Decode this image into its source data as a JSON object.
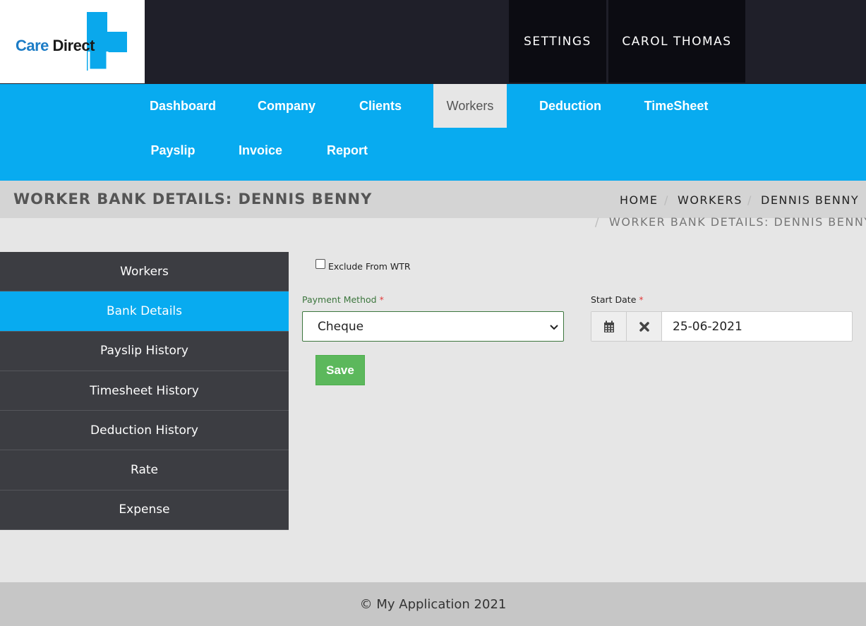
{
  "logo": {
    "text_care": "Care",
    "text_direct": "Direct"
  },
  "header": {
    "settings_label": "SETTINGS",
    "user_label": "CAROL THOMAS"
  },
  "nav": {
    "items": [
      {
        "label": "Dashboard",
        "active": false
      },
      {
        "label": "Company",
        "active": false
      },
      {
        "label": "Clients",
        "active": false
      },
      {
        "label": "Workers",
        "active": true
      },
      {
        "label": "Deduction",
        "active": false
      },
      {
        "label": "TimeSheet",
        "active": false
      },
      {
        "label": "Payslip",
        "active": false
      },
      {
        "label": "Invoice",
        "active": false
      },
      {
        "label": "Report",
        "active": false
      }
    ]
  },
  "page": {
    "title": "WORKER BANK DETAILS: DENNIS BENNY",
    "breadcrumb": {
      "home": "HOME",
      "workers": "WORKERS",
      "worker": "DENNIS BENNY",
      "current": "WORKER BANK DETAILS: DENNIS BENNY",
      "separator": "/"
    }
  },
  "sidebar": {
    "items": [
      {
        "label": "Workers",
        "active": false
      },
      {
        "label": "Bank Details",
        "active": true
      },
      {
        "label": "Payslip History",
        "active": false
      },
      {
        "label": "Timesheet History",
        "active": false
      },
      {
        "label": "Deduction History",
        "active": false
      },
      {
        "label": "Rate",
        "active": false
      },
      {
        "label": "Expense",
        "active": false
      }
    ]
  },
  "form": {
    "exclude_wtr_label": "Exclude From WTR",
    "exclude_wtr_checked": false,
    "payment_method_label": "Payment Method",
    "payment_method_value": "Cheque",
    "start_date_label": "Start Date",
    "start_date_value": "25-06-2021",
    "required_marker": "*",
    "save_label": "Save"
  },
  "footer": {
    "text": "© My Application 2021"
  },
  "colors": {
    "brand_blue": "#08abf0",
    "header_dark": "#1f1f29",
    "sidebar_dark": "#3c3d42",
    "save_green": "#5cb85c",
    "required_red": "#e23b3b"
  },
  "icons": {
    "logo": "care-direct-cross-logo",
    "calendar": "calendar-icon",
    "clear": "close-icon",
    "dropdown": "chevron-down-icon"
  }
}
